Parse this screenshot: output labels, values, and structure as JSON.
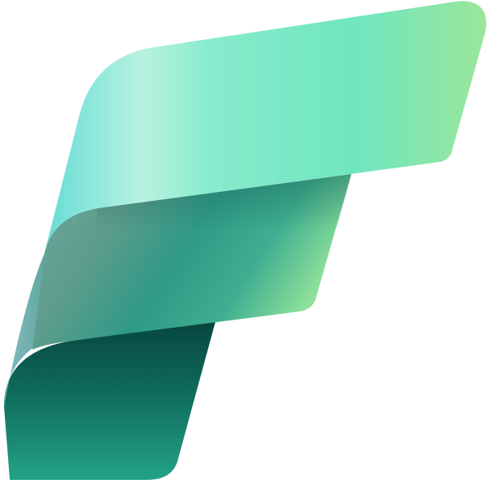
{
  "logo": {
    "icon_name": "fabric-f-logo-icon",
    "colors": {
      "top_band_start": "#66dcd6",
      "top_band_highlight": "#b8f2e0",
      "top_band_mid": "#6fe6c0",
      "top_band_end": "#9ae69a",
      "middle_band_start": "#6fa9a2",
      "middle_band_mid": "#2f9a86",
      "middle_band_end": "#8ee09a",
      "bottom_band_top": "#07463f",
      "bottom_band_bottom": "#23a286",
      "background": "#ffffff"
    }
  }
}
